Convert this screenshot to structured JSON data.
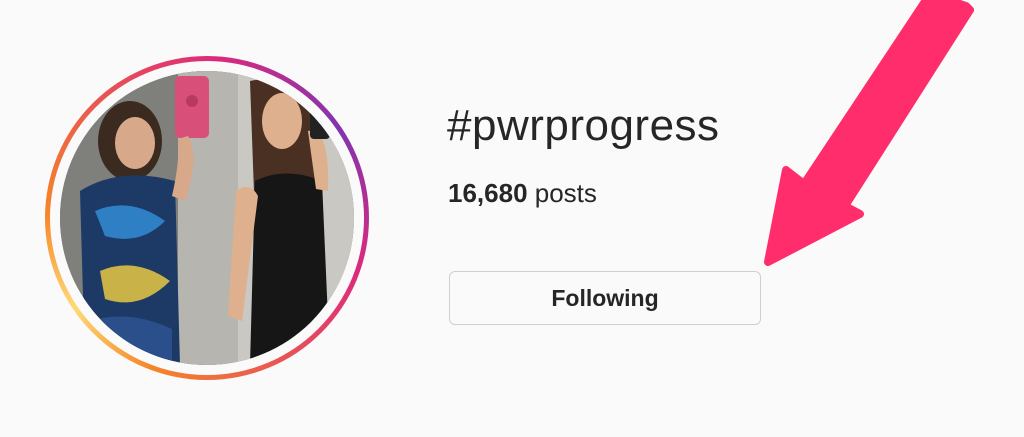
{
  "hashtag": {
    "title": "#pwrprogress",
    "post_count": "16,680",
    "post_label": " posts"
  },
  "follow_button": {
    "label": "Following"
  },
  "avatar": {
    "ring_colors": [
      "#f58529",
      "#dd2a7b",
      "#8134af"
    ],
    "icon": "profile-photo"
  },
  "annotation": {
    "arrow_color": "#ff2d6b",
    "icon": "arrow-pointer"
  }
}
